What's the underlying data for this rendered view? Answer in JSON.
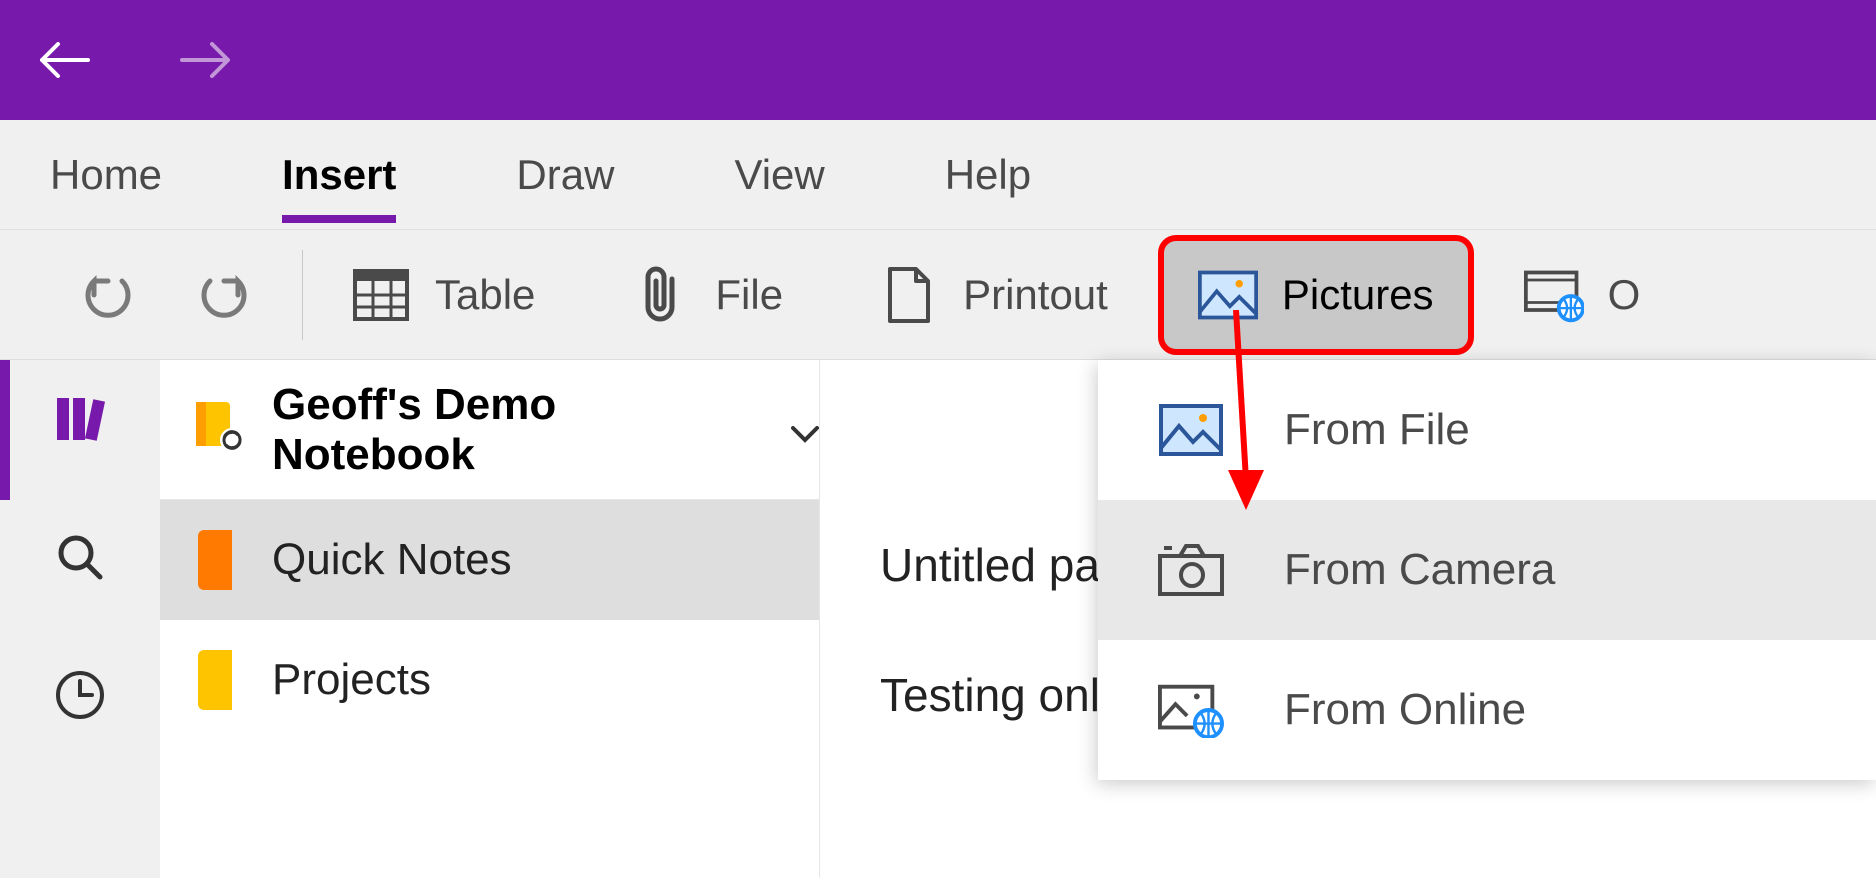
{
  "tabs": {
    "home": "Home",
    "insert": "Insert",
    "draw": "Draw",
    "view": "View",
    "help": "Help"
  },
  "ribbon": {
    "table": "Table",
    "file": "File",
    "printout": "Printout",
    "pictures": "Pictures",
    "online_initial": "O"
  },
  "notebook": {
    "name": "Geoff's Demo Notebook"
  },
  "sections": [
    {
      "name": "Quick Notes",
      "color": "#ff7a00"
    },
    {
      "name": "Projects",
      "color": "#ffc400"
    }
  ],
  "pages": [
    {
      "title": "Untitled pa"
    },
    {
      "title": "Testing only"
    }
  ],
  "pictures_menu": {
    "from_file": "From File",
    "from_camera": "From Camera",
    "from_online": "From Online"
  },
  "colors": {
    "brand": "#7719aa",
    "highlight_border": "#ff0000"
  }
}
